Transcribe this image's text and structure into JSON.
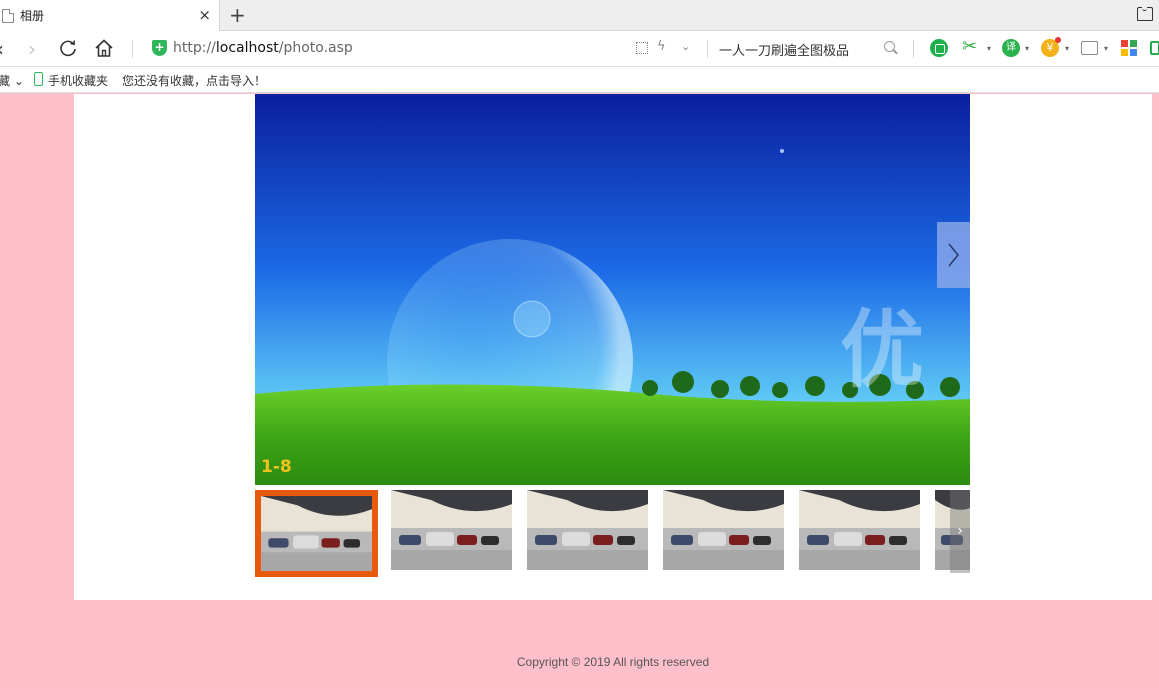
{
  "tab": {
    "title": "相册",
    "close": "×"
  },
  "new_tab": "+",
  "address": {
    "protocol": "http://",
    "host": "localhost",
    "path": "/photo.asp"
  },
  "search": {
    "text": "一人一刀刷遍全图极品"
  },
  "extensions": {
    "translate": "译",
    "money": "¥"
  },
  "bookmarks": {
    "favorites": "藏",
    "mobile": "手机收藏夹",
    "import": "您还没有收藏，点击导入！"
  },
  "gallery": {
    "counter": "1-8",
    "thumb_count": 6,
    "active_index": 0
  },
  "footer": {
    "copyright": "Copyright © 2019 All rights reserved"
  },
  "colors": {
    "page_bg": "#ffc0cb",
    "active_thumb": "#e75a0c",
    "counter": "#f5c21b"
  }
}
